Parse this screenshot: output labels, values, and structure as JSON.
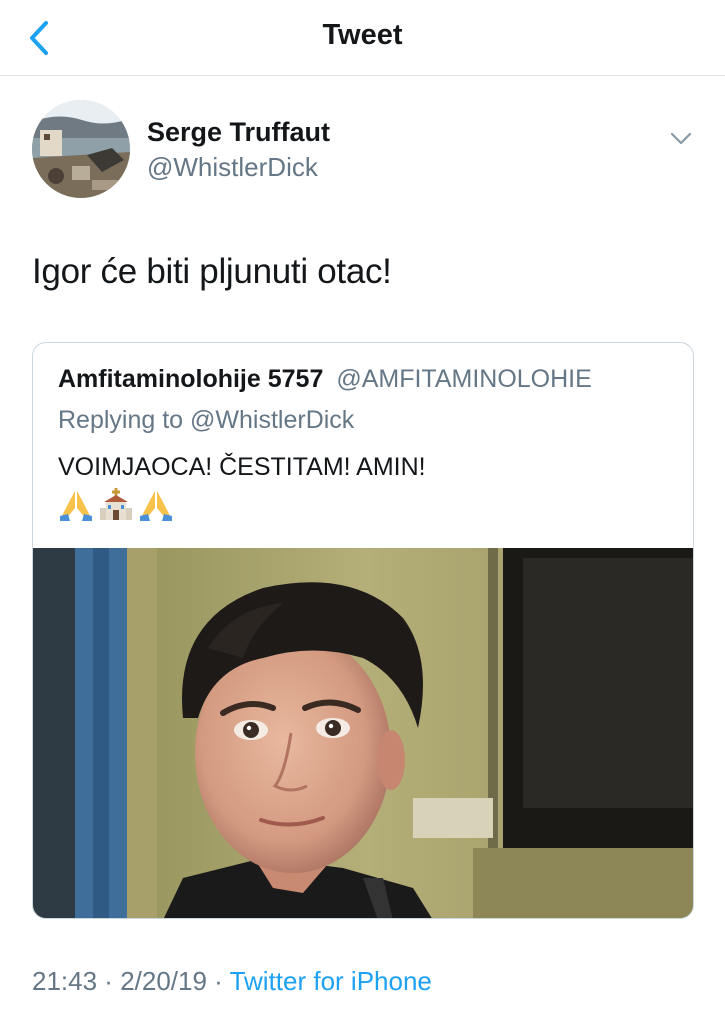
{
  "nav": {
    "title": "Tweet",
    "back_icon": "chevron-left-icon",
    "accent_color": "#1da1f2"
  },
  "tweet": {
    "author_name": "Serge Truffaut",
    "author_handle": "@WhistlerDick",
    "menu_icon": "chevron-down-icon",
    "text": "Igor će biti pljunuti otac!",
    "time": "21:43",
    "separator_1": " · ",
    "date": "2/20/19",
    "separator_2": " · ",
    "source": "Twitter for iPhone"
  },
  "quoted_tweet": {
    "author_name": "Amfitaminolohije 5757",
    "author_handle": "@AMFITAMINOLOHIE",
    "replying_prefix": "Replying to ",
    "replying_to": "@WhistlerDick",
    "text": "VOIMJAOCA! ČESTITAM! AMIN!",
    "emojis": [
      "folded-hands-icon",
      "church-icon",
      "folded-hands-icon"
    ]
  },
  "colors": {
    "primary_text": "#14171a",
    "secondary_text": "#657786",
    "link": "#1da1f2",
    "border": "#ccd6dd"
  }
}
